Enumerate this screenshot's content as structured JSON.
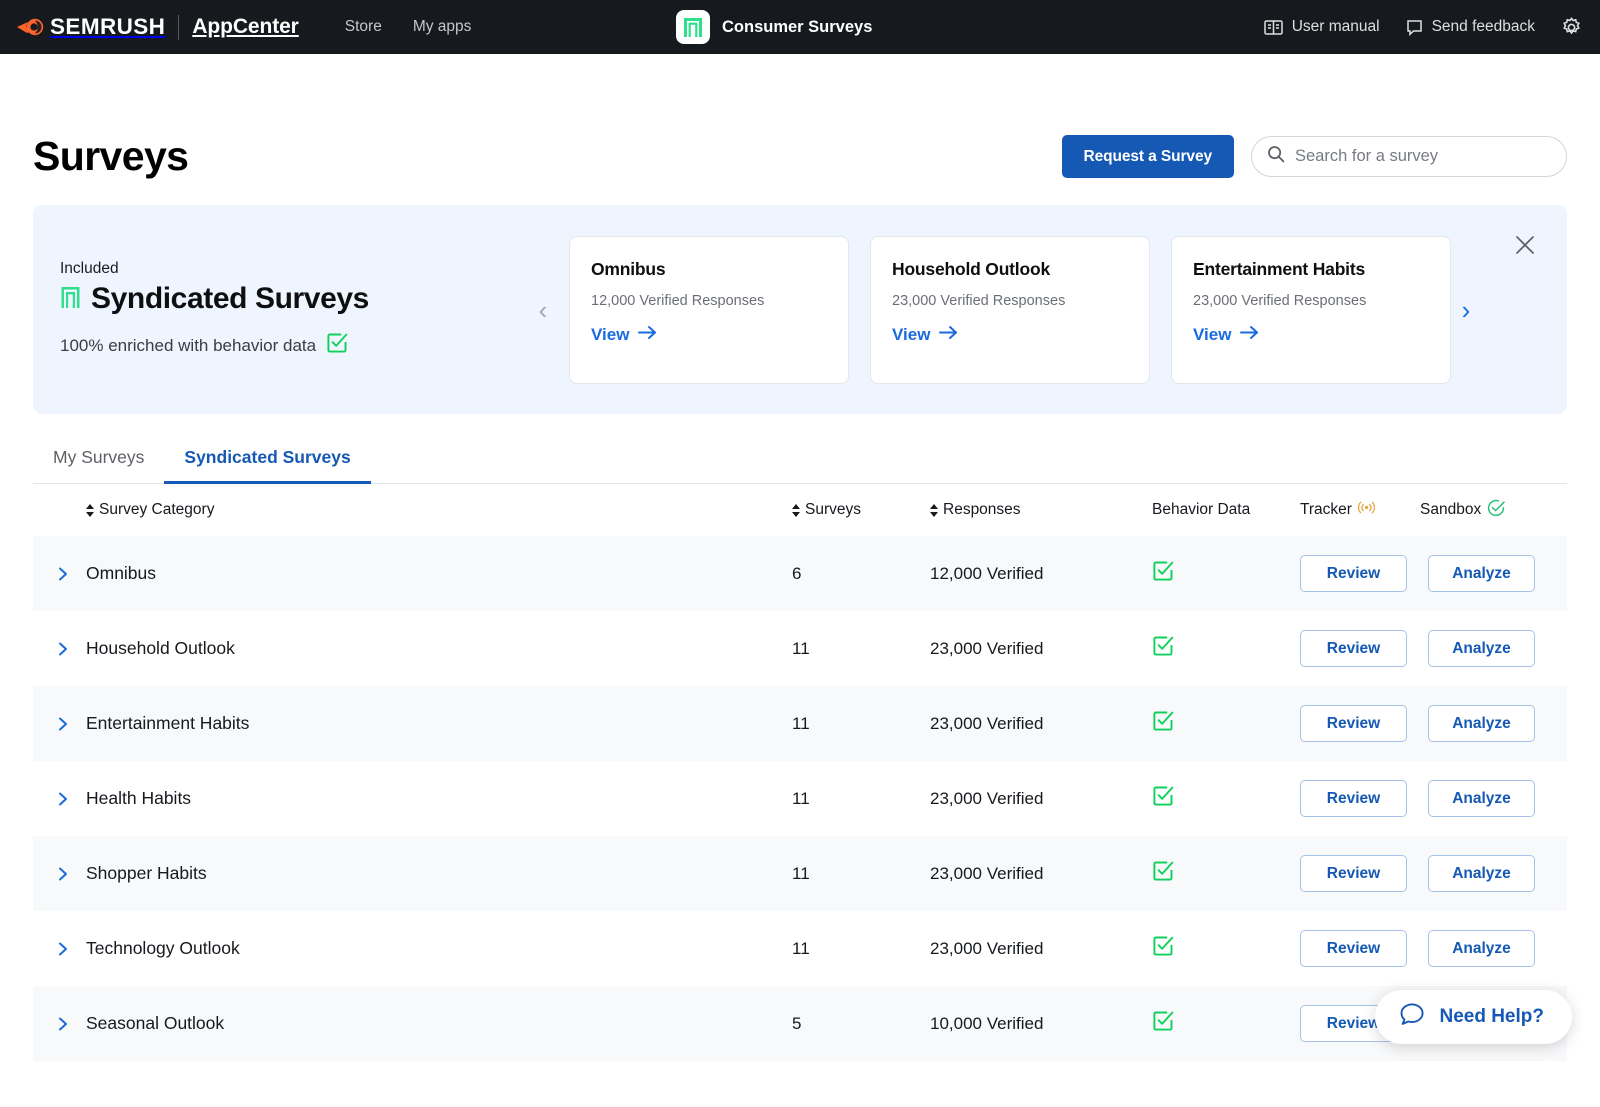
{
  "topbar": {
    "brand": "SEMRUSH",
    "product": "AppCenter",
    "nav": [
      {
        "label": "Store"
      },
      {
        "label": "My apps"
      }
    ],
    "app_title": "Consumer Surveys",
    "right_items": [
      {
        "label": "User manual",
        "icon": "book-icon"
      },
      {
        "label": "Send feedback",
        "icon": "message-icon"
      }
    ],
    "settings_icon": "gear-icon"
  },
  "page": {
    "title": "Surveys",
    "request_button": "Request a Survey",
    "search_placeholder": "Search for a survey",
    "search_value": ""
  },
  "banner": {
    "included_label": "Included",
    "title": "Syndicated Surveys",
    "subtitle": "100% enriched with behavior data",
    "prev_arrow": "‹",
    "next_arrow": "›",
    "close_icon": "close-icon",
    "view_label": "View",
    "cards": [
      {
        "title": "Omnibus",
        "responses": "12,000 Verified Responses"
      },
      {
        "title": "Household Outlook",
        "responses": "23,000 Verified Responses"
      },
      {
        "title": "Entertainment Habits",
        "responses": "23,000 Verified Responses"
      }
    ]
  },
  "tabs": [
    {
      "label": "My Surveys",
      "active": false
    },
    {
      "label": "Syndicated Surveys",
      "active": true
    }
  ],
  "table": {
    "columns": {
      "category": "Survey Category",
      "surveys": "Surveys",
      "responses": "Responses",
      "behavior": "Behavior Data",
      "tracker": "Tracker",
      "sandbox": "Sandbox"
    },
    "review_label": "Review",
    "analyze_label": "Analyze",
    "rows": [
      {
        "name": "Omnibus",
        "surveys": "6",
        "responses": "12,000 Verified"
      },
      {
        "name": "Household Outlook",
        "surveys": "11",
        "responses": "23,000 Verified"
      },
      {
        "name": "Entertainment Habits",
        "surveys": "11",
        "responses": "23,000 Verified"
      },
      {
        "name": "Health Habits",
        "surveys": "11",
        "responses": "23,000 Verified"
      },
      {
        "name": "Shopper Habits",
        "surveys": "11",
        "responses": "23,000 Verified"
      },
      {
        "name": "Technology Outlook",
        "surveys": "11",
        "responses": "23,000 Verified"
      },
      {
        "name": "Seasonal Outlook",
        "surveys": "5",
        "responses": "10,000 Verified"
      }
    ]
  },
  "help_widget": {
    "label": "Need Help?",
    "icon": "chat-bubble-icon"
  },
  "colors": {
    "accent_blue": "#1559b5",
    "link_blue": "#1a6ae0",
    "green": "#0ed15b",
    "orange": "#ff642d",
    "dark": "#16191d",
    "banner_bg": "#eef5fe"
  }
}
